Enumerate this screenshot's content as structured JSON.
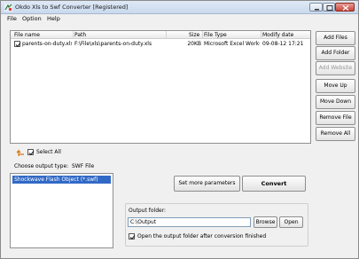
{
  "window": {
    "title": "Okdo Xls to Swf Converter [Registered]",
    "icon": "app-logo-icon"
  },
  "menu": {
    "items": [
      "File",
      "Option",
      "Help"
    ]
  },
  "file_list": {
    "columns": [
      "File name",
      "Path",
      "Size",
      "File Type",
      "Modify date"
    ],
    "rows": [
      {
        "checked": true,
        "name": "parents-on-duty.xls",
        "path": "F:\\File\\xls\\parents-on-duty.xls",
        "size": "20KB",
        "type": "Microsoft Excel Works...",
        "date": "09-08-12 17:21"
      }
    ]
  },
  "side_buttons": {
    "add_files": "Add Files",
    "add_folder": "Add Folder",
    "add_website": "Add Website",
    "move_up": "Move Up",
    "move_down": "Move Down",
    "remove_file": "Remove File",
    "remove_all": "Remove All"
  },
  "select_all": {
    "label": "Select All",
    "checked": true
  },
  "output_type": {
    "label": "Choose output type:",
    "value": "SWF File",
    "options": [
      "Shockwave Flash Object (*.swf)"
    ]
  },
  "actions": {
    "more_params": "Set more parameters",
    "convert": "Convert"
  },
  "output_folder": {
    "label": "Output folder:",
    "value": "C:\\Output",
    "browse": "Browse",
    "open": "Open",
    "open_after_label": "Open the output folder after conversion finished",
    "open_after_checked": true
  },
  "colors": {
    "selection": "#3169c6",
    "close_button": "#c7443a"
  }
}
